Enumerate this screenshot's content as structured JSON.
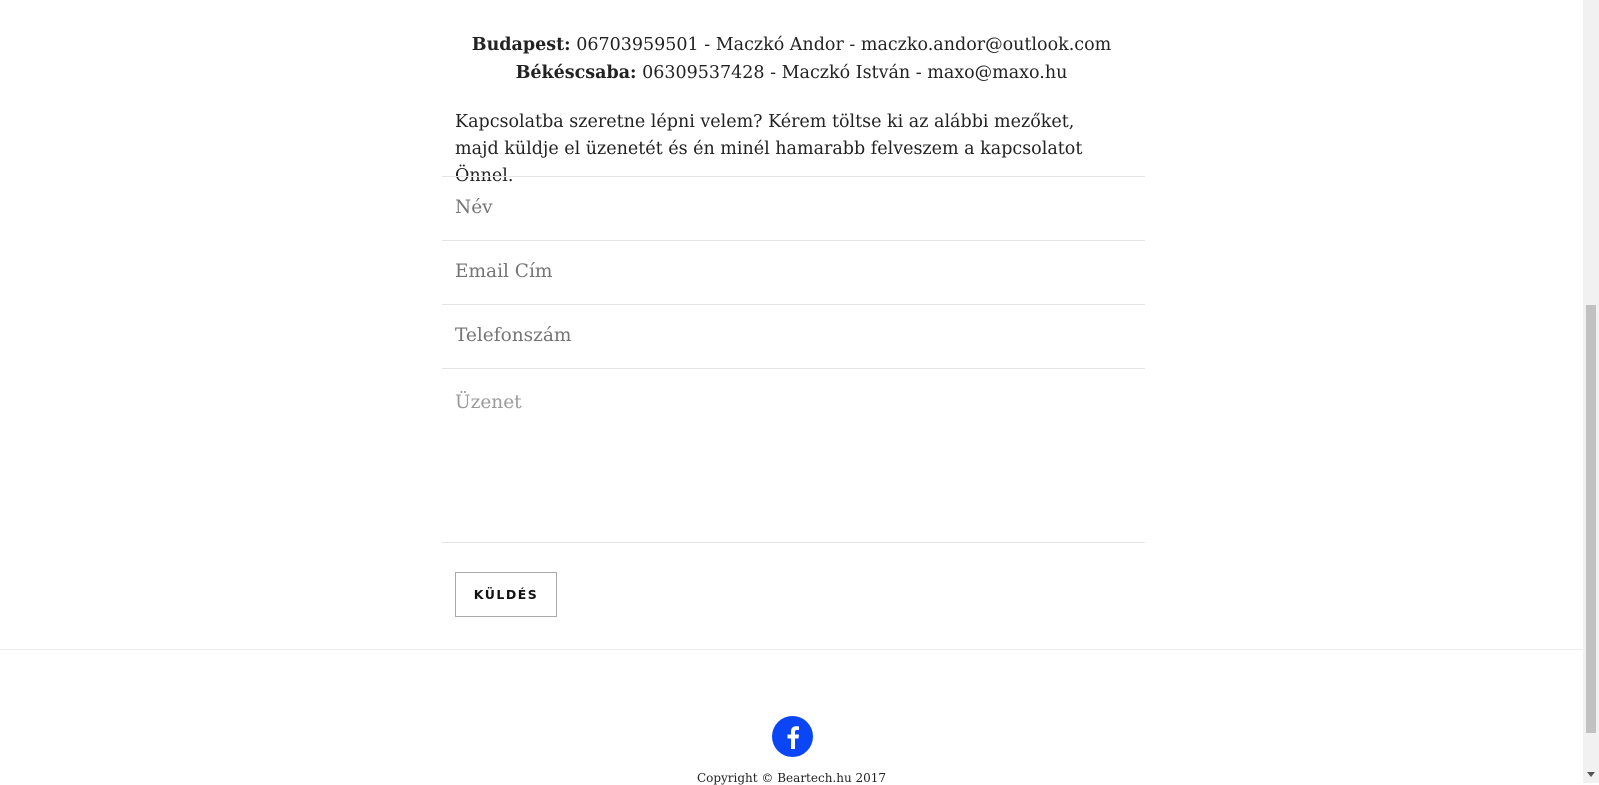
{
  "contacts": [
    {
      "city": "Budapest:",
      "details": " 06703959501 - Maczkó Andor - maczko.andor@outlook.com"
    },
    {
      "city": "Békéscsaba:",
      "details": " 06309537428 - Maczkó István - maxo@maxo.hu"
    }
  ],
  "intro": "Kapcsolatba szeretne lépni velem? Kérem töltse ki az alábbi mezőket, majd küldje el üzenetét és én minél hamarabb felveszem a kapcsolatot Önnel.",
  "form": {
    "name_placeholder": "Név",
    "email_placeholder": "Email Cím",
    "phone_placeholder": "Telefonszám",
    "message_placeholder": "Üzenet",
    "submit_label": "KÜLDÉS"
  },
  "footer": {
    "social_icon": "facebook-icon",
    "copyright": "Copyright © Beartech.hu 2017"
  },
  "colors": {
    "facebook": "#0a46f5"
  }
}
